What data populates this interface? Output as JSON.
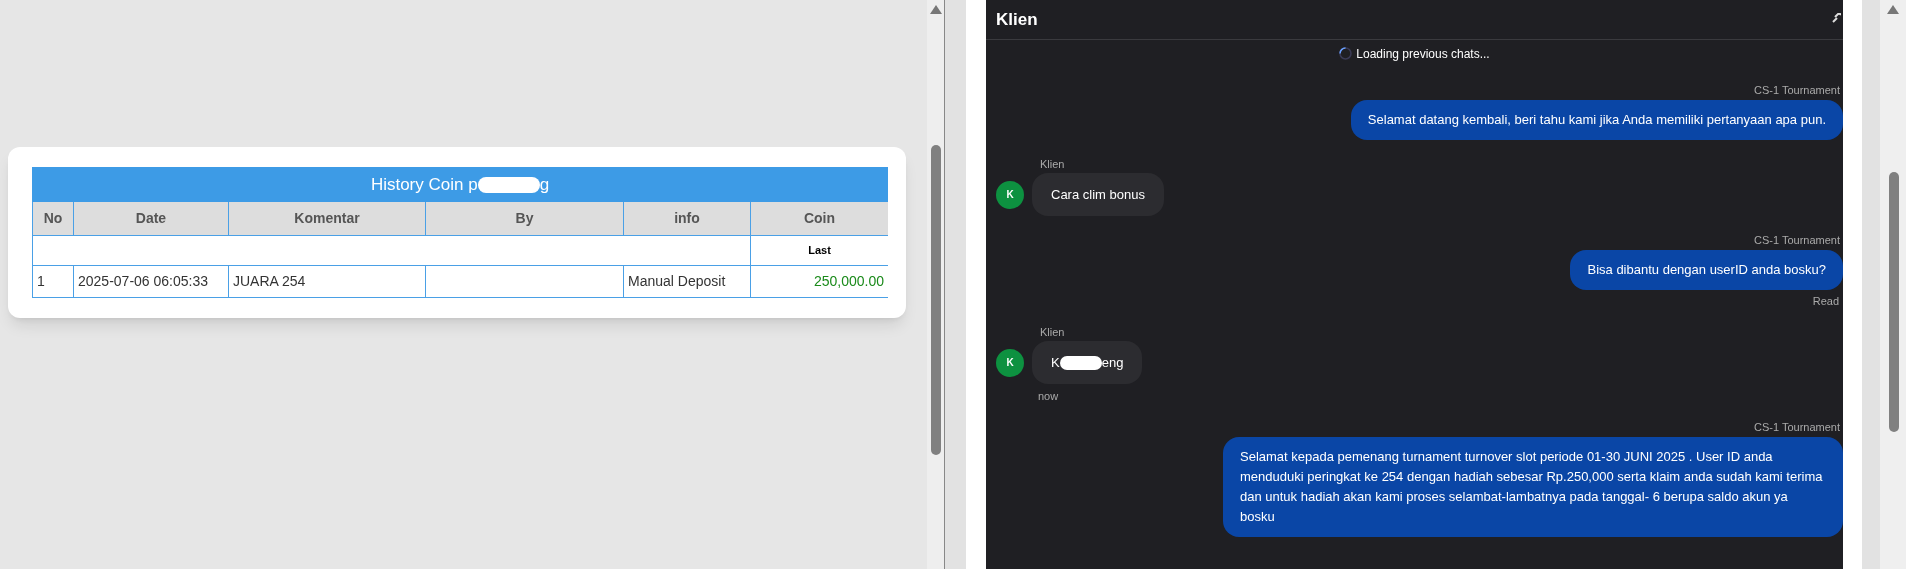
{
  "history_table": {
    "title_start": "History Coin p",
    "title_end": "g",
    "columns": [
      "No",
      "Date",
      "Komentar",
      "By",
      "info",
      "Coin"
    ],
    "subheader": "Last",
    "rows": [
      {
        "no": "1",
        "date": "2025-07-06 06:05:33",
        "komentar": "JUARA 254",
        "by": "",
        "info": "Manual Deposit",
        "coin": "250,000.00"
      }
    ]
  },
  "chat": {
    "title": "Klien",
    "loading": "Loading previous chats...",
    "messages": [
      {
        "kind": "agent",
        "sender": "CS-1 Tournament",
        "text": "Selamat datang kembali, beri tahu kami jika Anda memiliki pertanyaan apa pun."
      },
      {
        "kind": "client",
        "sender": "Klien",
        "avatar": "K",
        "text_start": "Cara clim bonus"
      },
      {
        "kind": "agent",
        "sender": "CS-1 Tournament",
        "text": "Bisa dibantu dengan userID anda bosku?",
        "status": "Read"
      },
      {
        "kind": "client",
        "sender": "Klien",
        "avatar": "K",
        "text_start": "K",
        "redacted": true,
        "text_end": "eng",
        "time": "now"
      },
      {
        "kind": "agent",
        "sender": "CS-1 Tournament",
        "text": "Selamat kepada pemenang turnament turnover slot periode 01-30 JUNI 2025 . User ID anda menduduki peringkat ke 254 dengan hadiah sebesar Rp.250,000 serta klaim anda sudah kami terima dan untuk hadiah akan kami proses selambat-lambatnya pada tanggal- 6 berupa saldo akun ya bosku"
      }
    ]
  }
}
